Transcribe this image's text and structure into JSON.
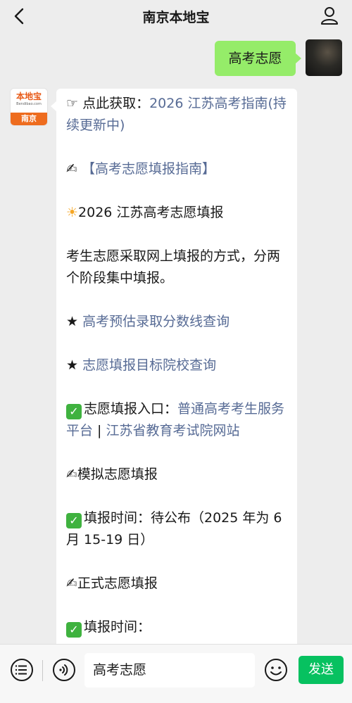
{
  "header": {
    "title": "南京本地宝",
    "back_icon": "chevron-left-icon",
    "profile_icon": "person-icon"
  },
  "chat": {
    "user_message": "高考志愿",
    "bot_logo": {
      "main": "本地宝",
      "url": "Bendibao.com",
      "city": "南京"
    },
    "bot_message": {
      "line1_prefix": "☞ 点此获取：",
      "line1_link": "2026 江苏高考指南(持续更新中)",
      "line2_emoji": "✍",
      "line2_link": "【高考志愿填报指南】",
      "line3_emoji": "☀",
      "line3_text": "2026 江苏高考志愿填报",
      "para4": "考生志愿采取网上填报的方式，分两个阶段集中填报。",
      "star": "★",
      "link5": "高考预估录取分数线查询",
      "link6": "志愿填报目标院校查询",
      "check": "✓",
      "line7_label": "志愿填报入口：",
      "line7_link_a": "普通高考考生服务平台",
      "line7_sep": " | ",
      "line7_link_b": "江苏省教育考试院网站",
      "line8": "模拟志愿填报",
      "line9": "填报时间：待公布（2025 年为 6 月 15-19 日）",
      "line10": "正式志愿填报",
      "line11": "填报时间："
    }
  },
  "composer": {
    "input_value": "高考志愿",
    "send_label": "发送",
    "menu_icon": "list-icon",
    "voice_icon": "voice-icon",
    "emoji_icon": "smile-icon"
  },
  "colors": {
    "link": "#576b95",
    "user_bubble": "#95ec69",
    "send_button": "#07c160",
    "brand_orange": "#ee6c1e"
  }
}
